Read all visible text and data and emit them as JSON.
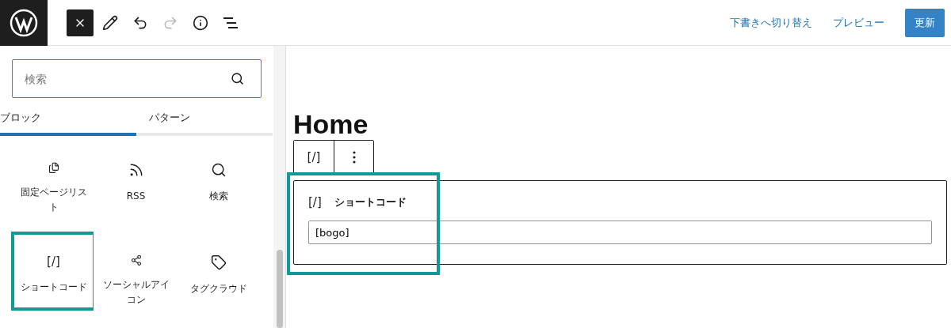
{
  "header": {
    "tools": [
      {
        "kind": "close",
        "selected": true,
        "disabled": false
      },
      {
        "kind": "edit",
        "selected": false,
        "disabled": false
      },
      {
        "kind": "undo",
        "selected": false,
        "disabled": false
      },
      {
        "kind": "redo",
        "selected": false,
        "disabled": true
      },
      {
        "kind": "info",
        "selected": false,
        "disabled": false
      },
      {
        "kind": "list",
        "selected": false,
        "disabled": false
      }
    ],
    "links": [
      "下書きへ切り替え",
      "プレビュー"
    ],
    "primary_button": "更新"
  },
  "sidebar": {
    "search": {
      "placeholder": "検索"
    },
    "tabs": [
      {
        "label": "ブロック",
        "selected": true
      },
      {
        "label": "パターン",
        "selected": false
      }
    ],
    "blocks": [
      {
        "kind": "page-list",
        "label": "固定ページリスト",
        "highlighted": false
      },
      {
        "kind": "rss",
        "label": "RSS",
        "highlighted": false
      },
      {
        "kind": "search",
        "label": "検索",
        "highlighted": false
      },
      {
        "kind": "shortcode",
        "glyph": "[/]",
        "label": "ショートコード",
        "highlighted": true
      },
      {
        "kind": "share",
        "label": "ソーシャルアイコン",
        "highlighted": false
      },
      {
        "kind": "tag",
        "label": "タグクラウド",
        "highlighted": false
      }
    ]
  },
  "editor": {
    "heading": "Home",
    "block_toolbar": {
      "glyph": "[/]"
    },
    "shortcode_block": {
      "glyph": "[/]",
      "title": "ショートコード",
      "value": "[bogo]",
      "highlighted": true
    }
  }
}
